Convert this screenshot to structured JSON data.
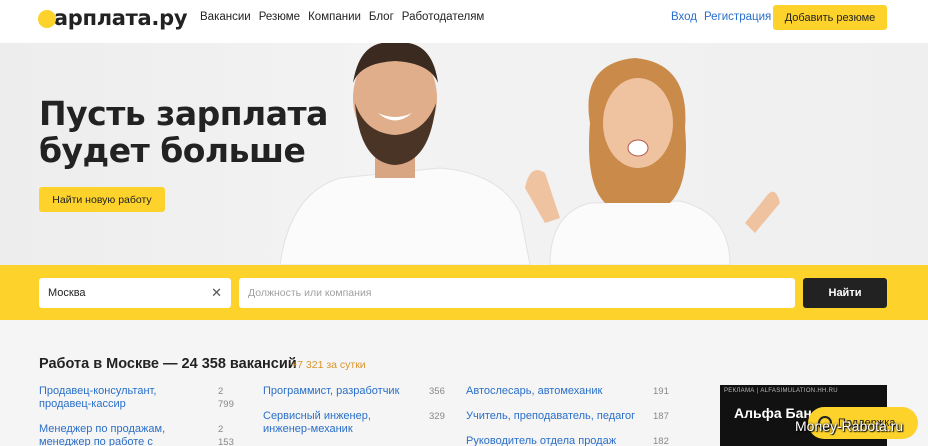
{
  "header": {
    "logo": "зарплата.ру",
    "nav": [
      "Вакансии",
      "Резюме",
      "Компании",
      "Блог",
      "Работодателям"
    ],
    "login": "Вход",
    "register": "Регистрация",
    "add_resume": "Добавить резюме"
  },
  "hero": {
    "title": "Пусть зарплата будет больше",
    "button": "Найти новую работу"
  },
  "search": {
    "city": "Москва",
    "query_placeholder": "Должность или компания",
    "find_button": "Найти"
  },
  "section": {
    "title": "Работа в Москве — 24 358 вакансий",
    "delta": "+7 321 за сутки"
  },
  "columns": [
    [
      {
        "title": "Продавец-консультант, продавец-кассир",
        "count": "2 799"
      },
      {
        "title": "Менеджер по продажам, менеджер по работе с клиентами",
        "count": "2 153"
      }
    ],
    [
      {
        "title": "Программист, разработчик",
        "count": "356"
      },
      {
        "title": "Сервисный инженер, инженер-механик",
        "count": "329"
      }
    ],
    [
      {
        "title": "Автослесарь, автомеханик",
        "count": "191"
      },
      {
        "title": "Учитель, преподаватель, педагог",
        "count": "187"
      },
      {
        "title": "Руководитель отдела продаж",
        "count": "182"
      }
    ]
  ],
  "ad": {
    "caption": "РЕКЛАМА | ALFASIMULATION.HH.RU",
    "title": "Альфа Бан"
  },
  "support": "Поддержка",
  "watermark": "Money-Rabota.ru",
  "colors": {
    "accent": "#fcd22b",
    "link": "#2a6fc9",
    "dark": "#222222"
  }
}
